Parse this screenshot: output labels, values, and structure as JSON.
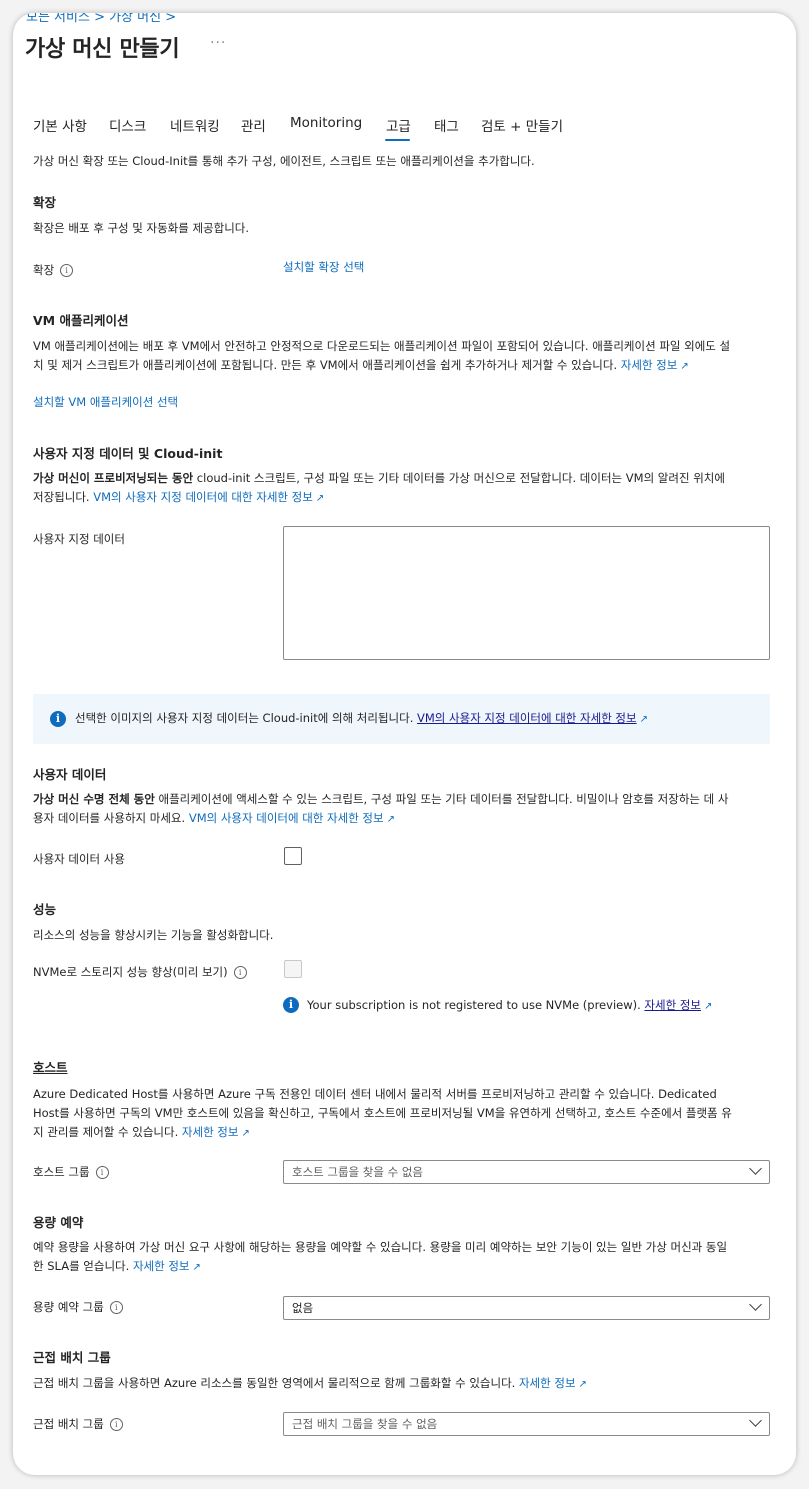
{
  "breadcrumb": "모든 서비스 > 가상 머신 >",
  "title": "가상 머신 만들기",
  "more": "···",
  "tabs": [
    "기본 사항",
    "디스크",
    "네트워킹",
    "관리",
    "Monitoring",
    "고급",
    "태그",
    "검토 + 만들기"
  ],
  "intro": "가상 머신 확장 또는 Cloud-Init를 통해 추가 구성, 에이전트, 스크립트 또는 애플리케이션을 추가합니다.",
  "extensions": {
    "heading": "확장",
    "desc": "확장은 배포 후 구성 및 자동화를 제공합니다.",
    "label": "확장",
    "link": "설치할 확장 선택"
  },
  "vmapps": {
    "heading": "VM 애플리케이션",
    "desc1": "VM 애플리케이션에는 배포 후 VM에서 안전하고 안정적으로 다운로드되는 애플리케이션 파일이 포함되어 있습니다. 애플리케이션 파일 외에도 설",
    "desc2": "치 및 제거 스크립트가 애플리케이션에 포함됩니다. 만든 후 VM에서 애플리케이션을 쉽게 추가하거나 제거할 수 있습니다.",
    "learn_more": "자세한 정보",
    "link": "설치할 VM 애플리케이션 선택"
  },
  "custom_data": {
    "heading": "사용자 지정 데이터 및 Cloud-init",
    "desc_bold": "가상 머신이 프로비저닝되는 동안",
    "desc_rest": " cloud-init 스크립트, 구성 파일 또는 기타 데이터를 가상 머신으로 전달합니다. 데이터는 VM의 알려진 위치에",
    "desc2": "저장됩니다.",
    "link": "VM의 사용자 지정 데이터에 대한 자세한 정보",
    "label": "사용자 지정 데이터",
    "value": "",
    "info_text": "선택한 이미지의 사용자 지정 데이터는 Cloud-init에 의해 처리됩니다.",
    "info_link": "VM의 사용자 지정 데이터에 대한 자세한 정보"
  },
  "user_data": {
    "heading": "사용자 데이터",
    "desc_bold": "가상 머신 수명 전체 동안",
    "desc_rest": " 애플리케이션에 액세스할 수 있는 스크립트, 구성 파일 또는 기타 데이터를 전달합니다. 비밀이나 암호를 저장하는 데 사",
    "desc2": "용자 데이터를 사용하지 마세요.",
    "link": "VM의 사용자 데이터에 대한 자세한 정보",
    "label": "사용자 데이터 사용",
    "checked": false
  },
  "performance": {
    "heading": "성능",
    "desc": "리소스의 성능을 향상시키는 기능을 활성화합니다.",
    "label": "NVMe로 스토리지 성능 향상(미리 보기)",
    "checked": false,
    "info_text": "Your subscription is not registered to use NVMe (preview).",
    "info_link": "자세한 정보"
  },
  "host": {
    "heading": "호스트",
    "desc1": "Azure Dedicated Host를 사용하면 Azure 구독 전용인 데이터 센터 내에서 물리적 서버를 프로비저닝하고 관리할 수 있습니다. Dedicated",
    "desc2": "Host를 사용하면 구독의 VM만 호스트에 있음을 확신하고, 구독에서 호스트에 프로비저닝될 VM을 유연하게 선택하고, 호스트 수준에서 플랫폼 유",
    "desc3": "지 관리를 제어할 수 있습니다.",
    "learn_more": "자세한 정보",
    "label": "호스트 그룹",
    "select_value": "호스트 그룹을 찾을 수 없음"
  },
  "capacity": {
    "heading": "용량 예약",
    "desc1": "예약 용량을 사용하여 가상 머신 요구 사항에 해당하는 용량을 예약할 수 있습니다. 용량을 미리 예약하는 보안 기능이 있는 일반 가상 머신과 동일",
    "desc2": "한 SLA를 얻습니다.",
    "learn_more": "자세한 정보",
    "label": "용량 예약 그룹",
    "select_value": "없음"
  },
  "proximity": {
    "heading": "근접 배치 그룹",
    "desc": "근접 배치 그룹을 사용하면 Azure 리소스를 동일한 영역에서 물리적으로 함께 그룹화할 수 있습니다.",
    "learn_more": "자세한 정보",
    "label": "근접 배치 그룹",
    "select_value": "근접 배치 그룹을 찾을 수 없음"
  },
  "icons": {
    "info": "info-icon",
    "external": "external-link-icon",
    "chevron": "chevron-down-icon"
  },
  "colors": {
    "accent": "#0f6cbd",
    "info_bar_bg": "#eff6fc"
  }
}
